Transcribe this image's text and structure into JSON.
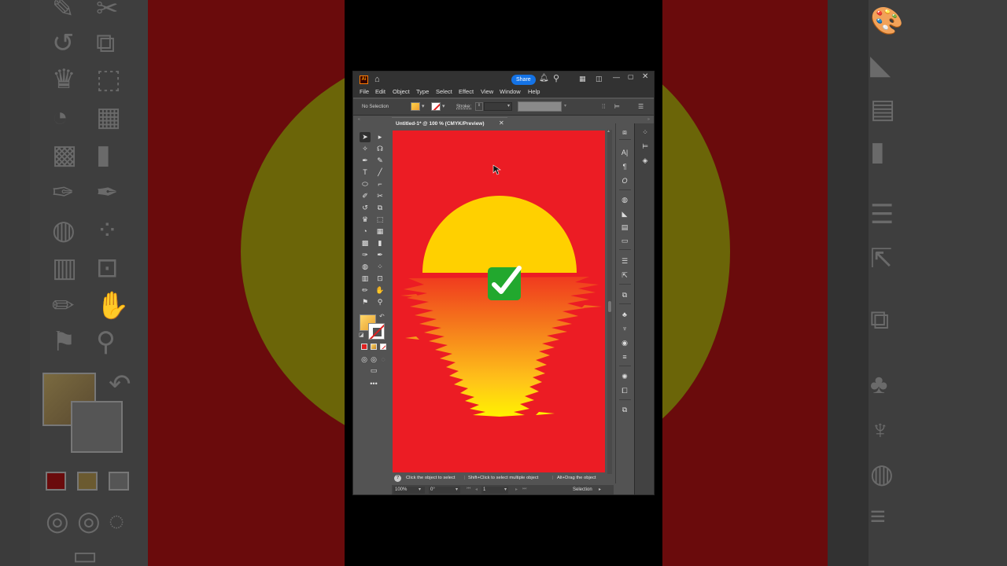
{
  "window": {
    "app_logo": "Ai",
    "share_label": "Share",
    "doc_tab": "Untitled-1* @ 100 % (CMYK/Preview)"
  },
  "menu": [
    "File",
    "Edit",
    "Object",
    "Type",
    "Select",
    "Effect",
    "View",
    "Window",
    "Help"
  ],
  "control_bar": {
    "selection": "No Selection",
    "stroke_label": "Stroke:"
  },
  "status_hint": {
    "icon": "?",
    "parts": [
      "Click the object to select",
      "Shift+Click to select multiple object",
      "Alt+Drag the object"
    ]
  },
  "status_bar": {
    "zoom": "100%",
    "rotation": "0°",
    "page": "1",
    "tool": "Selection"
  },
  "colors": {
    "artboard": "#ec1c24",
    "sun": "#ffd000",
    "accent": "#1473e6",
    "check_badge": "#22a82e"
  },
  "icons": {
    "tools": [
      "selection-tool-icon",
      "direct-selection-tool-icon",
      "magic-wand-icon",
      "lasso-icon",
      "pen-icon",
      "curvature-icon",
      "type-icon",
      "line-segment-icon",
      "ellipse-icon",
      "paintbrush-icon",
      "shaper-icon",
      "scissors-icon",
      "rotate-icon",
      "scale-icon",
      "warp-icon",
      "free-transform-icon",
      "shape-builder-icon",
      "perspective-icon",
      "mesh-icon",
      "gradient-icon",
      "eyedropper-icon",
      "eyedropper-alt-icon",
      "blend-icon",
      "symbol-sprayer-icon",
      "column-graph-icon",
      "artboard-icon",
      "slice-icon",
      "hand-icon",
      "hand-alt-icon",
      "zoom-icon"
    ],
    "dock1": [
      "properties-icon",
      "character-icon",
      "paragraph-icon",
      "opentype-icon",
      "color-guide-icon",
      "transparency-icon",
      "swatches-icon",
      "gradient-panel-icon",
      "align-icon",
      "export-icon",
      "pathfinder-icon",
      "symbols-icon",
      "brushes-icon",
      "appearance-icon",
      "stroke-panel-icon",
      "graphic-styles-icon",
      "links-icon",
      "artboards-icon"
    ],
    "dock2": [
      "libraries-icon",
      "assets-icon",
      "layers-icon"
    ]
  }
}
